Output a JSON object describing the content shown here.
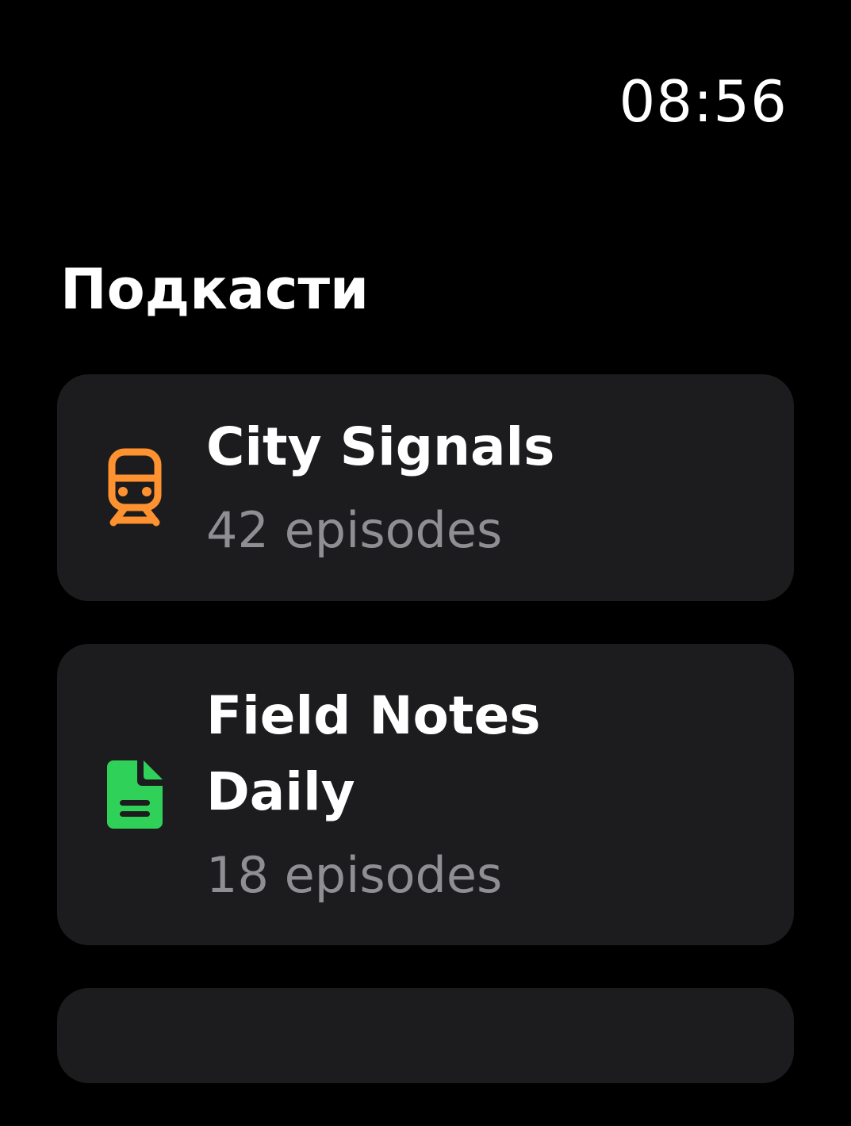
{
  "status": {
    "time": "08:56"
  },
  "header": {
    "title": "Подкасти"
  },
  "colors": {
    "background": "#000000",
    "card": "#1c1c1e",
    "secondary_text": "#8e8e93",
    "accent_orange": "#ff9230",
    "accent_green": "#30d158"
  },
  "podcasts": [
    {
      "title": "City Signals",
      "episodes": "42 episodes",
      "icon": "tram-icon"
    },
    {
      "title": "Field Notes Daily",
      "episodes": "18 episodes",
      "icon": "document-icon"
    }
  ]
}
